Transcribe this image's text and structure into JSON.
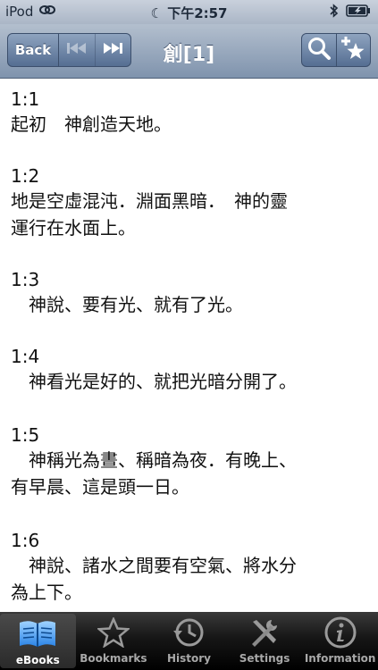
{
  "status_bar": {
    "carrier": "iPod",
    "time": "下午2:57"
  },
  "nav": {
    "back_label": "Back",
    "title": "創[1]"
  },
  "verses": [
    {
      "ref": "1:1",
      "lines": [
        "起初　神創造天地。"
      ]
    },
    {
      "ref": "1:2",
      "lines": [
        "地是空虛混沌．淵面黑暗．　神的靈",
        "運行在水面上。"
      ]
    },
    {
      "ref": "1:3",
      "lines": [
        "　神說、要有光、就有了光。"
      ]
    },
    {
      "ref": "1:4",
      "lines": [
        "　神看光是好的、就把光暗分開了。"
      ]
    },
    {
      "ref": "1:5",
      "lines": [
        "　神稱光為晝、稱暗為夜．有晚上、",
        "有早晨、這是頭一日。"
      ]
    },
    {
      "ref": "1:6",
      "lines": [
        "　神說、諸水之間要有空氣、將水分",
        "為上下。"
      ]
    }
  ],
  "tabs": [
    {
      "label": "eBooks",
      "icon": "book-icon",
      "active": true
    },
    {
      "label": "Bookmarks",
      "icon": "star-icon",
      "active": false
    },
    {
      "label": "History",
      "icon": "history-clock-icon",
      "active": false
    },
    {
      "label": "Settings",
      "icon": "tools-icon",
      "active": false
    },
    {
      "label": "Information",
      "icon": "info-icon",
      "active": false
    }
  ],
  "colors": {
    "nav_accent": "#7f93ad",
    "tab_active_icon": "#5aa8ff"
  }
}
